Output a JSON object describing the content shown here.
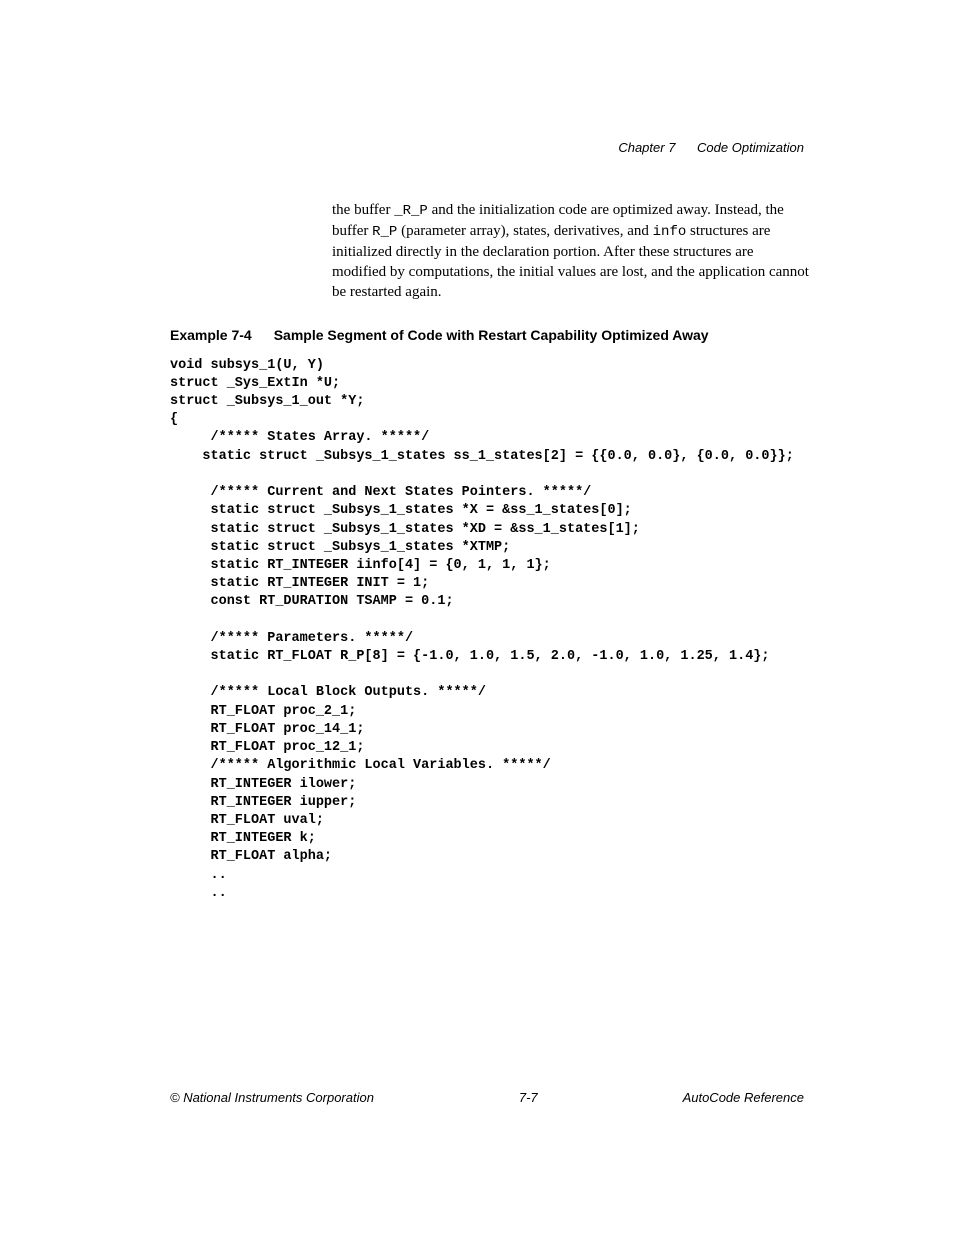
{
  "header": {
    "chapter_label": "Chapter 7",
    "chapter_title": "Code Optimization"
  },
  "body": {
    "para_pre": "the buffer ",
    "mono1": "_R_P",
    "para_mid1": " and the initialization code are optimized away. Instead, the buffer ",
    "mono2": "R_P",
    "para_mid2": " (parameter array), states, derivatives, and ",
    "mono3": "info",
    "para_post": " structures are initialized directly in the declaration portion. After these structures are modified by computations, the initial values are lost, and the application cannot be restarted again."
  },
  "example": {
    "label": "Example 7-4",
    "title": "Sample Segment of Code with Restart Capability Optimized Away"
  },
  "code": "void subsys_1(U, Y)\nstruct _Sys_ExtIn *U;\nstruct _Subsys_1_out *Y;\n{\n     /***** States Array. *****/\n    static struct _Subsys_1_states ss_1_states[2] = {{0.0, 0.0}, {0.0, 0.0}};\n\n     /***** Current and Next States Pointers. *****/\n     static struct _Subsys_1_states *X = &ss_1_states[0];\n     static struct _Subsys_1_states *XD = &ss_1_states[1];\n     static struct _Subsys_1_states *XTMP;\n     static RT_INTEGER iinfo[4] = {0, 1, 1, 1};\n     static RT_INTEGER INIT = 1;\n     const RT_DURATION TSAMP = 0.1;\n\n     /***** Parameters. *****/\n     static RT_FLOAT R_P[8] = {-1.0, 1.0, 1.5, 2.0, -1.0, 1.0, 1.25, 1.4};\n\n     /***** Local Block Outputs. *****/\n     RT_FLOAT proc_2_1;\n     RT_FLOAT proc_14_1;\n     RT_FLOAT proc_12_1;\n     /***** Algorithmic Local Variables. *****/\n     RT_INTEGER ilower;\n     RT_INTEGER iupper;\n     RT_FLOAT uval;\n     RT_INTEGER k;\n     RT_FLOAT alpha;\n     ..\n     ..",
  "footer": {
    "copyright": "© National Instruments Corporation",
    "page_num": "7-7",
    "doc_title": "AutoCode Reference"
  }
}
